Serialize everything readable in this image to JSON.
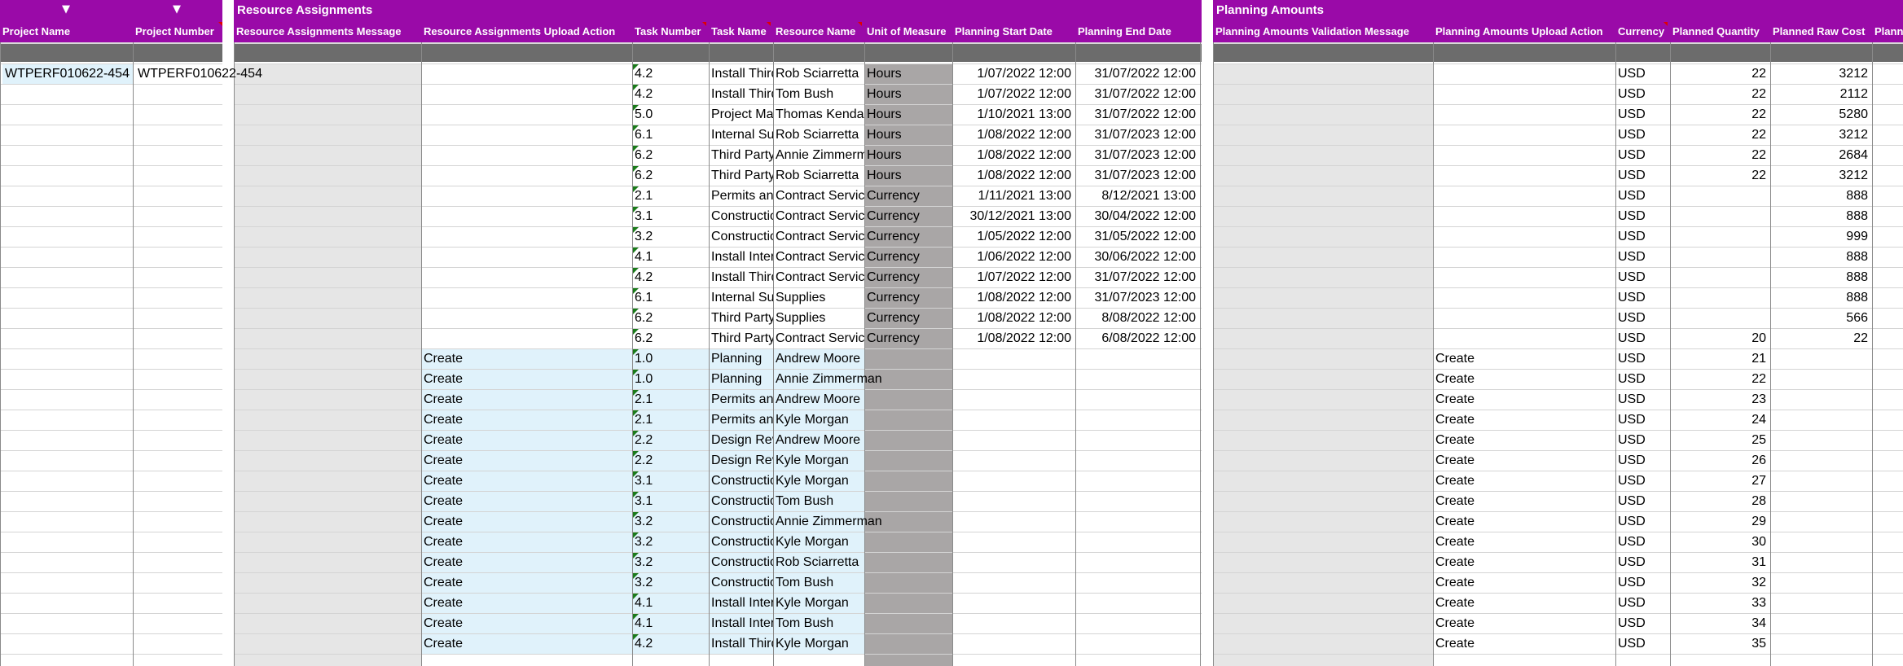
{
  "sections": {
    "resource_title": "Resource Assignments",
    "planning_title": "Planning Amounts"
  },
  "filter_glyph": "▼",
  "headers": {
    "project_name": "Project Name",
    "project_number": "Project Number",
    "ra_message": "Resource Assignments Message",
    "ra_upload_action": "Resource Assignments Upload Action",
    "task_number": "Task Number",
    "task_name": "Task Name",
    "resource_name": "Resource Name",
    "unit_of_measure": "Unit of Measure",
    "planning_start_date": "Planning Start Date",
    "planning_end_date": "Planning End Date",
    "pa_validation_message": "Planning Amounts Validation Message",
    "pa_upload_action": "Planning Amounts Upload Action",
    "currency": "Currency",
    "planned_quantity": "Planned Quantity",
    "planned_raw_cost": "Planned Raw Cost",
    "planned_more": "Planned"
  },
  "project": {
    "name": "WTPERF010622-454",
    "number": "WTPERF010622-454"
  },
  "rows": [
    {
      "ra_action": "",
      "task": "4.2",
      "task_name": "Install Third",
      "resource": "Rob Sciarretta",
      "uom": "Hours",
      "start": "1/07/2022 12:00",
      "end": "31/07/2022 12:00",
      "pa_action": "",
      "currency": "USD",
      "qty": "22",
      "cost": "3212"
    },
    {
      "ra_action": "",
      "task": "4.2",
      "task_name": "Install Third",
      "resource": "Tom Bush",
      "uom": "Hours",
      "start": "1/07/2022 12:00",
      "end": "31/07/2022 12:00",
      "pa_action": "",
      "currency": "USD",
      "qty": "22",
      "cost": "2112"
    },
    {
      "ra_action": "",
      "task": "5.0",
      "task_name": "Project Management",
      "resource": "Thomas Kendall",
      "uom": "Hours",
      "start": "1/10/2021 13:00",
      "end": "31/07/2022 12:00",
      "pa_action": "",
      "currency": "USD",
      "qty": "22",
      "cost": "5280"
    },
    {
      "ra_action": "",
      "task": "6.1",
      "task_name": "Internal Support",
      "resource": "Rob Sciarretta",
      "uom": "Hours",
      "start": "1/08/2022 12:00",
      "end": "31/07/2023 12:00",
      "pa_action": "",
      "currency": "USD",
      "qty": "22",
      "cost": "3212"
    },
    {
      "ra_action": "",
      "task": "6.2",
      "task_name": "Third Party",
      "resource": "Annie Zimmerman",
      "uom": "Hours",
      "start": "1/08/2022 12:00",
      "end": "31/07/2023 12:00",
      "pa_action": "",
      "currency": "USD",
      "qty": "22",
      "cost": "2684"
    },
    {
      "ra_action": "",
      "task": "6.2",
      "task_name": "Third Party",
      "resource": "Rob Sciarretta",
      "uom": "Hours",
      "start": "1/08/2022 12:00",
      "end": "31/07/2023 12:00",
      "pa_action": "",
      "currency": "USD",
      "qty": "22",
      "cost": "3212"
    },
    {
      "ra_action": "",
      "task": "2.1",
      "task_name": "Permits and",
      "resource": "Contract Services",
      "uom": "Currency",
      "start": "1/11/2021 13:00",
      "end": "8/12/2021 13:00",
      "pa_action": "",
      "currency": "USD",
      "qty": "",
      "cost": "888"
    },
    {
      "ra_action": "",
      "task": "3.1",
      "task_name": "Construction",
      "resource": "Contract Services",
      "uom": "Currency",
      "start": "30/12/2021 13:00",
      "end": "30/04/2022 12:00",
      "pa_action": "",
      "currency": "USD",
      "qty": "",
      "cost": "888"
    },
    {
      "ra_action": "",
      "task": "3.2",
      "task_name": "Construction",
      "resource": "Contract Services",
      "uom": "Currency",
      "start": "1/05/2022 12:00",
      "end": "31/05/2022 12:00",
      "pa_action": "",
      "currency": "USD",
      "qty": "",
      "cost": "999"
    },
    {
      "ra_action": "",
      "task": "4.1",
      "task_name": "Install Internal",
      "resource": "Contract Services",
      "uom": "Currency",
      "start": "1/06/2022 12:00",
      "end": "30/06/2022 12:00",
      "pa_action": "",
      "currency": "USD",
      "qty": "",
      "cost": "888"
    },
    {
      "ra_action": "",
      "task": "4.2",
      "task_name": "Install Third",
      "resource": "Contract Services",
      "uom": "Currency",
      "start": "1/07/2022 12:00",
      "end": "31/07/2022 12:00",
      "pa_action": "",
      "currency": "USD",
      "qty": "",
      "cost": "888"
    },
    {
      "ra_action": "",
      "task": "6.1",
      "task_name": "Internal Support",
      "resource": "Supplies",
      "uom": "Currency",
      "start": "1/08/2022 12:00",
      "end": "31/07/2023 12:00",
      "pa_action": "",
      "currency": "USD",
      "qty": "",
      "cost": "888"
    },
    {
      "ra_action": "",
      "task": "6.2",
      "task_name": "Third Party",
      "resource": "Supplies",
      "uom": "Currency",
      "start": "1/08/2022 12:00",
      "end": "8/08/2022 12:00",
      "pa_action": "",
      "currency": "USD",
      "qty": "",
      "cost": "566"
    },
    {
      "ra_action": "",
      "task": "6.2",
      "task_name": "Third Party",
      "resource": "Contract Services",
      "uom": "Currency",
      "start": "1/08/2022 12:00",
      "end": "6/08/2022 12:00",
      "pa_action": "",
      "currency": "USD",
      "qty": "20",
      "cost": "22"
    },
    {
      "ra_action": "Create",
      "task": "1.0",
      "task_name": "Planning",
      "resource": "Andrew Moore",
      "uom": "",
      "start": "",
      "end": "",
      "pa_action": "Create",
      "currency": "USD",
      "qty": "21",
      "cost": ""
    },
    {
      "ra_action": "Create",
      "task": "1.0",
      "task_name": "Planning",
      "resource": "Annie Zimmerman",
      "uom": "",
      "start": "",
      "end": "",
      "pa_action": "Create",
      "currency": "USD",
      "qty": "22",
      "cost": ""
    },
    {
      "ra_action": "Create",
      "task": "2.1",
      "task_name": "Permits and",
      "resource": "Andrew Moore",
      "uom": "",
      "start": "",
      "end": "",
      "pa_action": "Create",
      "currency": "USD",
      "qty": "23",
      "cost": ""
    },
    {
      "ra_action": "Create",
      "task": "2.1",
      "task_name": "Permits and",
      "resource": "Kyle Morgan",
      "uom": "",
      "start": "",
      "end": "",
      "pa_action": "Create",
      "currency": "USD",
      "qty": "24",
      "cost": ""
    },
    {
      "ra_action": "Create",
      "task": "2.2",
      "task_name": "Design Review",
      "resource": "Andrew Moore",
      "uom": "",
      "start": "",
      "end": "",
      "pa_action": "Create",
      "currency": "USD",
      "qty": "25",
      "cost": ""
    },
    {
      "ra_action": "Create",
      "task": "2.2",
      "task_name": "Design Review",
      "resource": "Kyle Morgan",
      "uom": "",
      "start": "",
      "end": "",
      "pa_action": "Create",
      "currency": "USD",
      "qty": "26",
      "cost": ""
    },
    {
      "ra_action": "Create",
      "task": "3.1",
      "task_name": "Construction",
      "resource": "Kyle Morgan",
      "uom": "",
      "start": "",
      "end": "",
      "pa_action": "Create",
      "currency": "USD",
      "qty": "27",
      "cost": ""
    },
    {
      "ra_action": "Create",
      "task": "3.1",
      "task_name": "Construction",
      "resource": "Tom Bush",
      "uom": "",
      "start": "",
      "end": "",
      "pa_action": "Create",
      "currency": "USD",
      "qty": "28",
      "cost": ""
    },
    {
      "ra_action": "Create",
      "task": "3.2",
      "task_name": "Construction",
      "resource": "Annie Zimmerman",
      "uom": "",
      "start": "",
      "end": "",
      "pa_action": "Create",
      "currency": "USD",
      "qty": "29",
      "cost": ""
    },
    {
      "ra_action": "Create",
      "task": "3.2",
      "task_name": "Construction",
      "resource": "Kyle Morgan",
      "uom": "",
      "start": "",
      "end": "",
      "pa_action": "Create",
      "currency": "USD",
      "qty": "30",
      "cost": ""
    },
    {
      "ra_action": "Create",
      "task": "3.2",
      "task_name": "Construction",
      "resource": "Rob Sciarretta",
      "uom": "",
      "start": "",
      "end": "",
      "pa_action": "Create",
      "currency": "USD",
      "qty": "31",
      "cost": ""
    },
    {
      "ra_action": "Create",
      "task": "3.2",
      "task_name": "Construction",
      "resource": "Tom Bush",
      "uom": "",
      "start": "",
      "end": "",
      "pa_action": "Create",
      "currency": "USD",
      "qty": "32",
      "cost": ""
    },
    {
      "ra_action": "Create",
      "task": "4.1",
      "task_name": "Install Internal",
      "resource": "Kyle Morgan",
      "uom": "",
      "start": "",
      "end": "",
      "pa_action": "Create",
      "currency": "USD",
      "qty": "33",
      "cost": ""
    },
    {
      "ra_action": "Create",
      "task": "4.1",
      "task_name": "Install Internal",
      "resource": "Tom Bush",
      "uom": "",
      "start": "",
      "end": "",
      "pa_action": "Create",
      "currency": "USD",
      "qty": "34",
      "cost": ""
    },
    {
      "ra_action": "Create",
      "task": "4.2",
      "task_name": "Install Third",
      "resource": "Kyle Morgan",
      "uom": "",
      "start": "",
      "end": "",
      "pa_action": "Create",
      "currency": "USD",
      "qty": "35",
      "cost": ""
    }
  ],
  "colors": {
    "header": "#9a0aa8",
    "subheader": "#6c6c6c",
    "message_column": "#e6e6e6",
    "uom_column": "#a9a6a6",
    "create_rows": "#e0f2fb",
    "task_marker": "#1a7a1a"
  }
}
